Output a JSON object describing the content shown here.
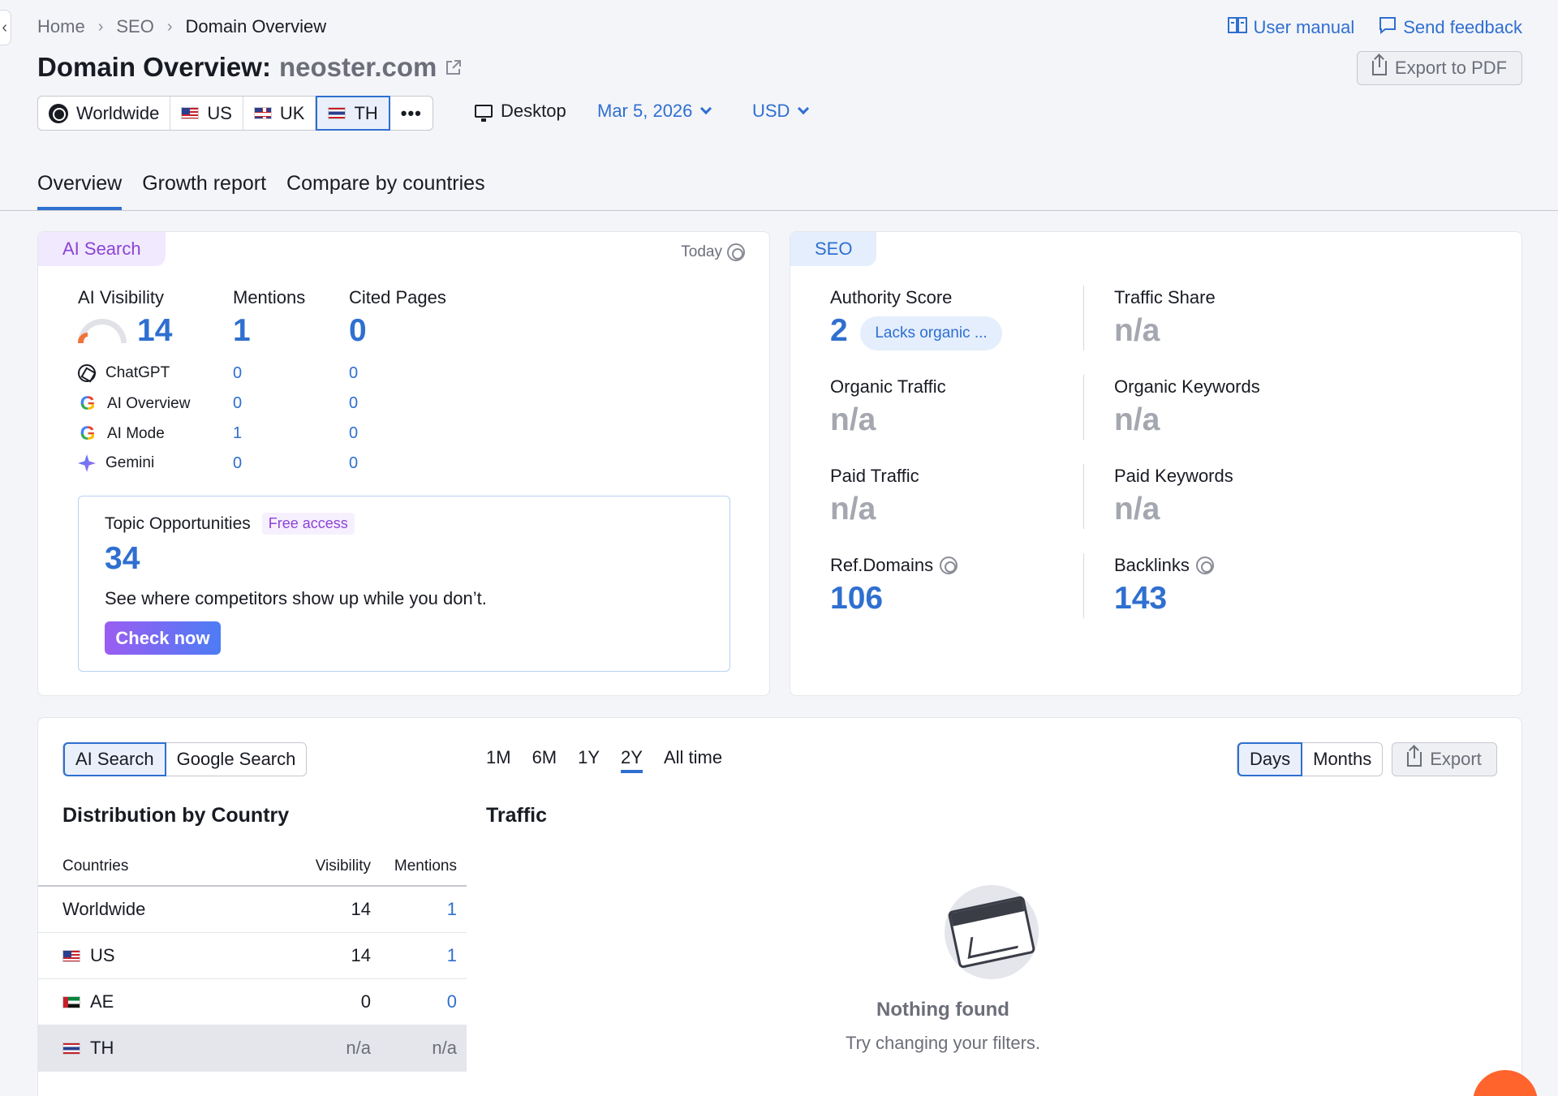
{
  "breadcrumb": {
    "home": "Home",
    "seo": "SEO",
    "current": "Domain Overview"
  },
  "top_links": {
    "manual": "User manual",
    "feedback": "Send feedback"
  },
  "header": {
    "title_prefix": "Domain Overview:",
    "domain": "neoster.com",
    "export_pdf": "Export to PDF"
  },
  "databases": [
    {
      "label": "Worldwide",
      "icon": "globe-icon",
      "active": false
    },
    {
      "label": "US",
      "icon": "us-flag-icon",
      "active": false
    },
    {
      "label": "UK",
      "icon": "uk-flag-icon",
      "active": false
    },
    {
      "label": "TH",
      "icon": "th-flag-icon",
      "active": true
    }
  ],
  "more_label": "•••",
  "device": "Desktop",
  "date": "Mar 5, 2026",
  "currency": "USD",
  "tabs": [
    "Overview",
    "Growth report",
    "Compare by countries"
  ],
  "ai_card": {
    "tag": "AI Search",
    "today": "Today",
    "visibility_label": "AI Visibility",
    "visibility_value": "14",
    "mentions_label": "Mentions",
    "mentions_value": "1",
    "cited_label": "Cited Pages",
    "cited_value": "0",
    "sources": [
      {
        "name": "ChatGPT",
        "icon": "chatgpt-icon",
        "mentions": "0",
        "cited": "0"
      },
      {
        "name": "AI Overview",
        "icon": "google-icon",
        "mentions": "0",
        "cited": "0"
      },
      {
        "name": "AI Mode",
        "icon": "google-icon",
        "mentions": "1",
        "cited": "0"
      },
      {
        "name": "Gemini",
        "icon": "gemini-icon",
        "mentions": "0",
        "cited": "0"
      }
    ],
    "topic": {
      "title": "Topic Opportunities",
      "badge": "Free access",
      "value": "34",
      "desc": "See where competitors show up while you don’t.",
      "button": "Check now"
    }
  },
  "seo_card": {
    "tag": "SEO",
    "authority_label": "Authority Score",
    "authority_value": "2",
    "authority_badge": "Lacks organic ...",
    "traffic_share_label": "Traffic Share",
    "traffic_share_value": "n/a",
    "organic_traffic_label": "Organic Traffic",
    "organic_traffic_value": "n/a",
    "organic_keywords_label": "Organic Keywords",
    "organic_keywords_value": "n/a",
    "paid_traffic_label": "Paid Traffic",
    "paid_traffic_value": "n/a",
    "paid_keywords_label": "Paid Keywords",
    "paid_keywords_value": "n/a",
    "ref_domains_label": "Ref.Domains",
    "ref_domains_value": "106",
    "backlinks_label": "Backlinks",
    "backlinks_value": "143"
  },
  "bottom": {
    "source_toggle": [
      "AI Search",
      "Google Search"
    ],
    "periods": [
      "1M",
      "6M",
      "1Y",
      "2Y",
      "All time"
    ],
    "active_period": "2Y",
    "granularity": [
      "Days",
      "Months"
    ],
    "export": "Export",
    "dist_title": "Distribution by Country",
    "traffic_title": "Traffic",
    "table_headers": {
      "country": "Countries",
      "visibility": "Visibility",
      "mentions": "Mentions"
    },
    "rows": [
      {
        "country": "Worldwide",
        "flag": "",
        "visibility": "14",
        "mentions": "1"
      },
      {
        "country": "US",
        "flag": "us",
        "visibility": "14",
        "mentions": "1"
      },
      {
        "country": "AE",
        "flag": "ae",
        "visibility": "0",
        "mentions": "0"
      },
      {
        "country": "TH",
        "flag": "th",
        "visibility": "n/a",
        "mentions": "n/a"
      }
    ],
    "empty_title": "Nothing found",
    "empty_sub": "Try changing your filters."
  },
  "colors": {
    "accent": "#2f6fd0",
    "ai_purple": "#8b44d6",
    "muted": "#a5a7b0",
    "fab": "#ff642d"
  }
}
